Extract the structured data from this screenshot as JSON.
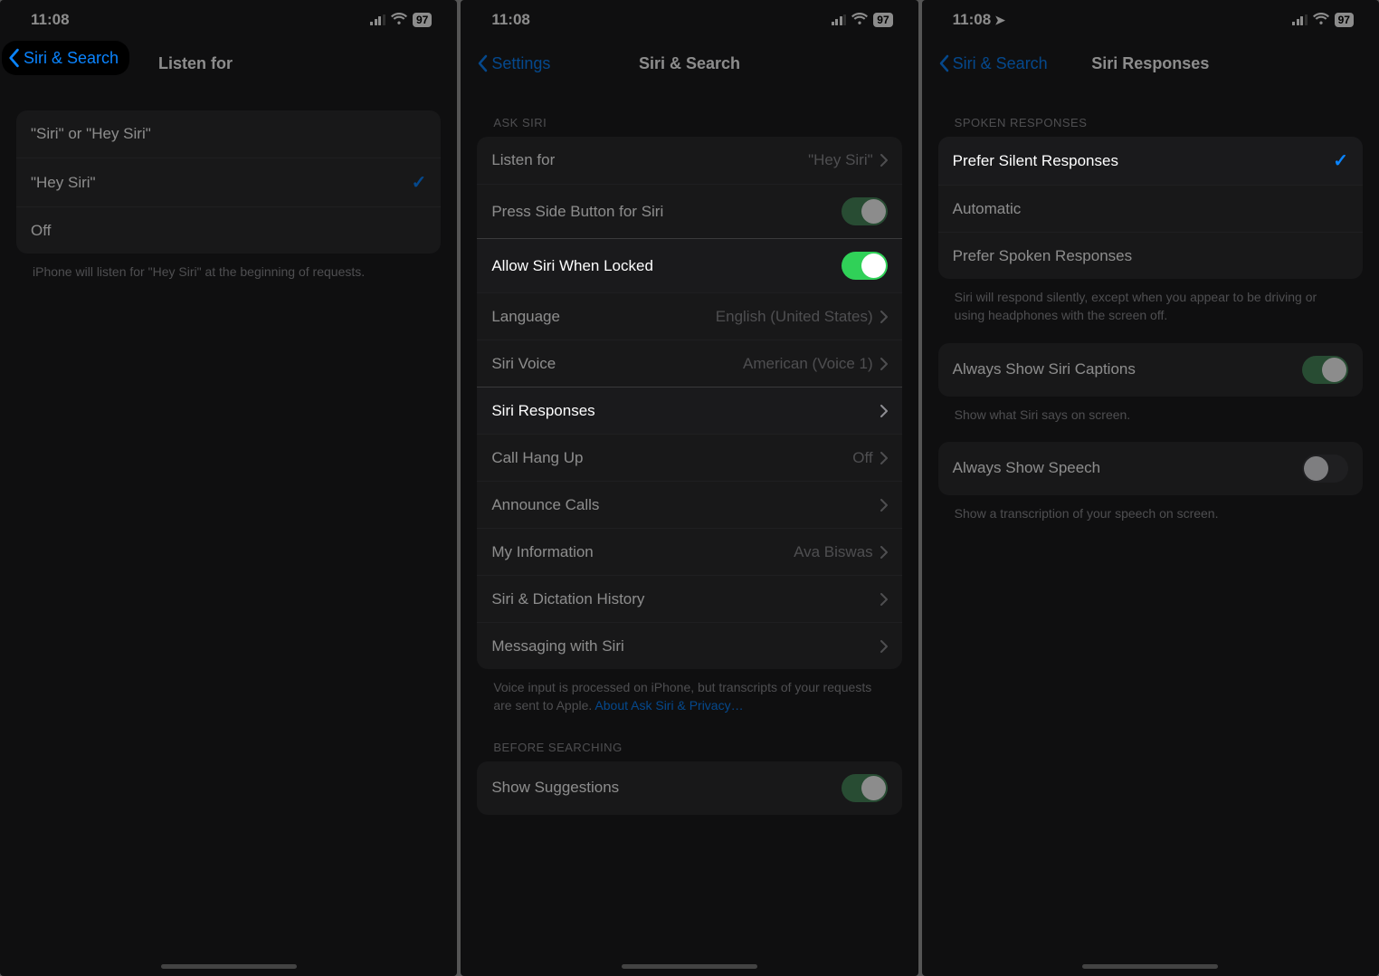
{
  "left": {
    "status_time": "11:08",
    "battery": "97",
    "back_label": "Siri & Search",
    "title": "Listen for",
    "rows": [
      {
        "label": "\"Siri\" or \"Hey Siri\"",
        "checked": false
      },
      {
        "label": "\"Hey Siri\"",
        "checked": true
      },
      {
        "label": "Off",
        "checked": false
      }
    ],
    "footer": "iPhone will listen for \"Hey Siri\" at the beginning of requests."
  },
  "middle": {
    "status_time": "11:08",
    "battery": "97",
    "back_label": "Settings",
    "title": "Siri & Search",
    "section1_header": "ASK SIRI",
    "rows": {
      "listen_for": {
        "label": "Listen for",
        "value": "\"Hey Siri\""
      },
      "press_side": {
        "label": "Press Side Button for Siri",
        "toggle": true
      },
      "allow_locked": {
        "label": "Allow Siri When Locked",
        "toggle": true
      },
      "language": {
        "label": "Language",
        "value": "English (United States)"
      },
      "siri_voice": {
        "label": "Siri Voice",
        "value": "American (Voice 1)"
      },
      "siri_responses": {
        "label": "Siri Responses"
      },
      "call_hangup": {
        "label": "Call Hang Up",
        "value": "Off"
      },
      "announce_calls": {
        "label": "Announce Calls"
      },
      "my_information": {
        "label": "My Information",
        "value": "Ava Biswas"
      },
      "history": {
        "label": "Siri & Dictation History"
      },
      "messaging": {
        "label": "Messaging with Siri"
      }
    },
    "footer_text": "Voice input is processed on iPhone, but transcripts of your requests are sent to Apple. ",
    "footer_link": "About Ask Siri & Privacy…",
    "section2_header": "BEFORE SEARCHING",
    "show_suggestions": {
      "label": "Show Suggestions",
      "toggle": true
    }
  },
  "right": {
    "status_time": "11:08",
    "battery": "97",
    "back_label": "Siri & Search",
    "title": "Siri Responses",
    "section1_header": "SPOKEN RESPONSES",
    "spoken_rows": [
      {
        "label": "Prefer Silent Responses",
        "checked": true
      },
      {
        "label": "Automatic",
        "checked": false
      },
      {
        "label": "Prefer Spoken Responses",
        "checked": false
      }
    ],
    "spoken_footer": "Siri will respond silently, except when you appear to be driving or using headphones with the screen off.",
    "captions": {
      "label": "Always Show Siri Captions",
      "toggle": true
    },
    "captions_footer": "Show what Siri says on screen.",
    "speech": {
      "label": "Always Show Speech",
      "toggle": false
    },
    "speech_footer": "Show a transcription of your speech on screen."
  }
}
